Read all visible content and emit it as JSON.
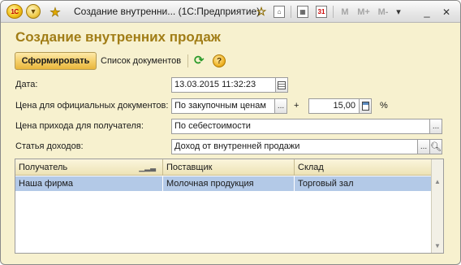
{
  "titlebar": {
    "logo": "1C",
    "title": "Создание внутренни... (1С:Предприятие)",
    "m_buttons": [
      "M",
      "M+",
      "M-"
    ],
    "calendar_day": "31",
    "menu_arrow": "▾",
    "minimize": "_",
    "close": "✕"
  },
  "page": {
    "title": "Создание внутренних продаж"
  },
  "toolbar": {
    "generate_label": "Сформировать",
    "documents_label": "Список документов",
    "help_glyph": "?"
  },
  "form": {
    "date": {
      "label": "Дата:",
      "value": "13.03.2015 11:32:23"
    },
    "official_price": {
      "label": "Цена для официальных документов:",
      "value": "По закупочным ценам",
      "plus": "+",
      "percent_value": "15,00",
      "percent_sign": "%"
    },
    "receipt_price": {
      "label": "Цена прихода для получателя:",
      "value": "По себестоимости"
    },
    "income_item": {
      "label": "Статья доходов:",
      "value": "Доход от внутренней продажи"
    }
  },
  "table": {
    "columns": [
      "Получатель",
      "Поставщик",
      "Склад"
    ],
    "rows": [
      [
        "Наша фирма",
        "Молочная продукция",
        "Торговый зал"
      ]
    ]
  },
  "icons": {
    "ellipsis": "...",
    "scroll_up": "▲",
    "scroll_down": "▼"
  }
}
